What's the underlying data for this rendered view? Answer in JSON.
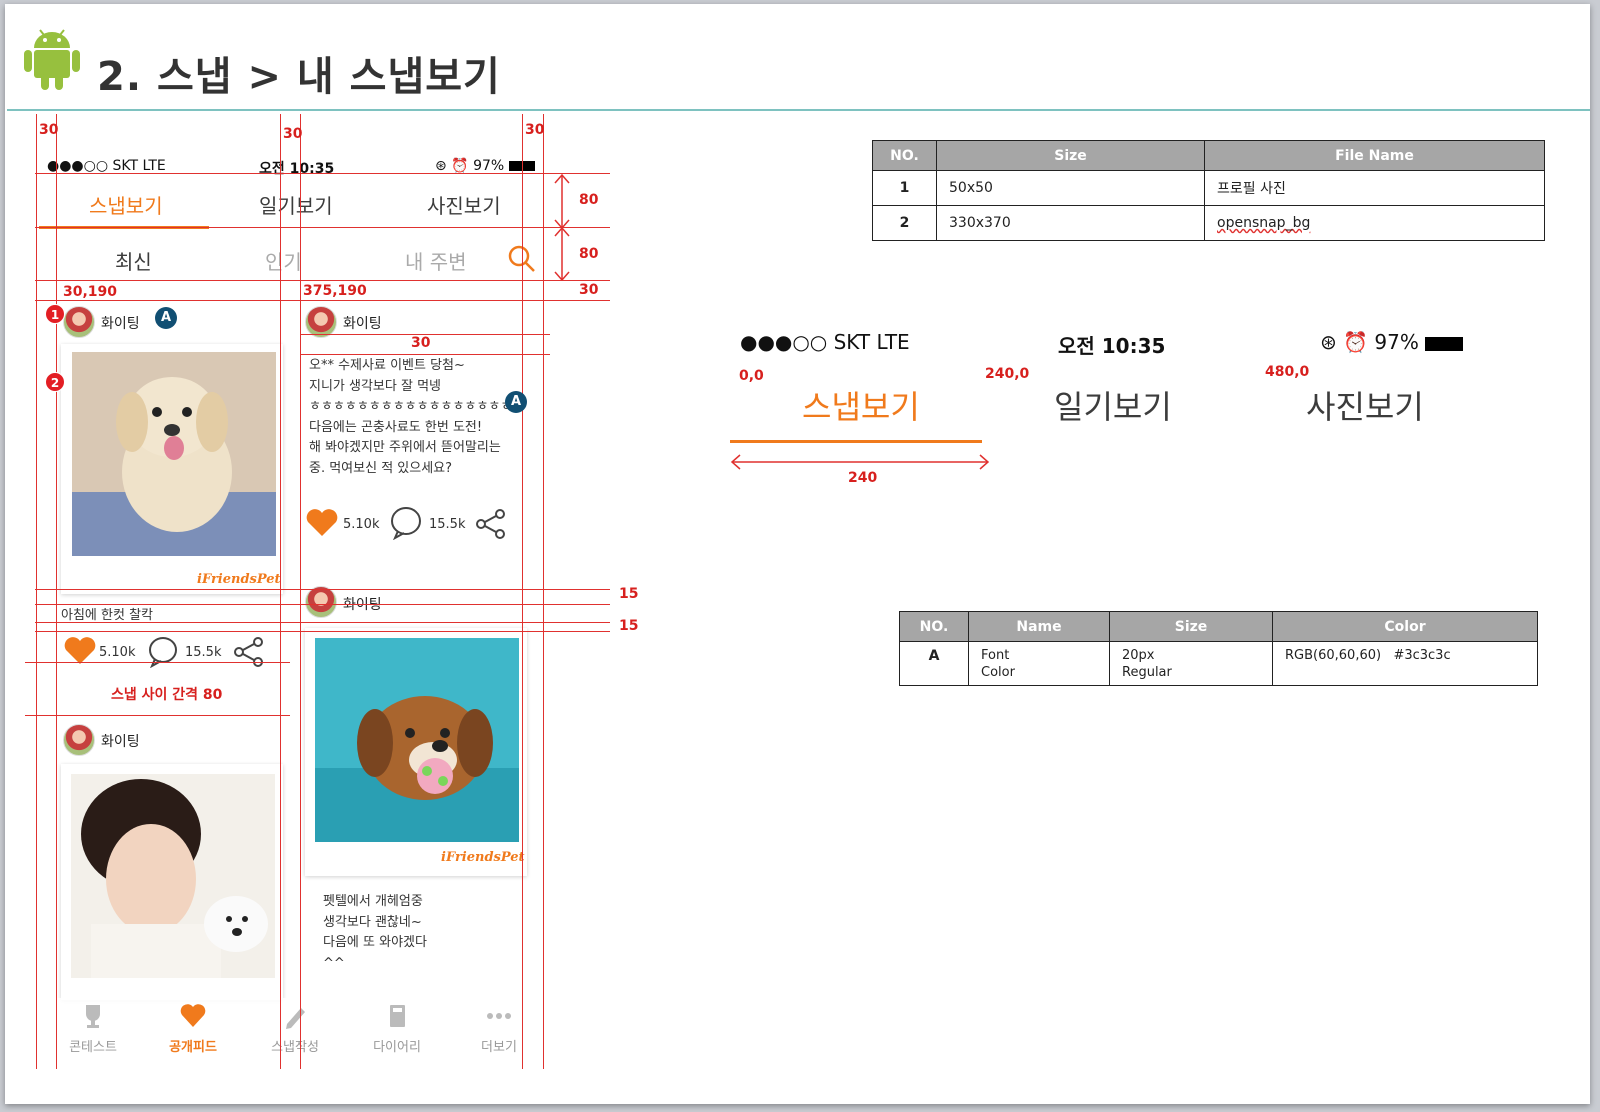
{
  "title": "2. 스냅 > 내 스냅보기",
  "status_bar": {
    "carrier": "●●●○○ SKT   LTE",
    "time": "오전 10:35",
    "battery": "97%"
  },
  "tabs": [
    "스냅보기",
    "일기보기",
    "사진보기"
  ],
  "subtabs": [
    "최신",
    "인기",
    "내 주변"
  ],
  "posts": {
    "user": "화이팅",
    "left1_caption": "아침에 한컷 찰칵",
    "right1_text": "오** 수제사료 이벤트 당첨~\n지니가 생각보다 잘 먹넹\nㅎㅎㅎㅎㅎㅎㅎㅎㅎㅎㅎㅎㅎㅎㅎㅎㅎ\n다음에는 곤충사료도 한번 도전!\n해 봐야겠지만 주위에서 뜯어말리는\n중. 먹여보신 적 있으세요?",
    "right2_text": "펫텔에서 개헤엄중\n생각보다 괜찮네~\n다음에 또 와야겠다\n^^",
    "likes": "5.10k",
    "comments": "15.5k",
    "brand": "iFriendsPet"
  },
  "bottom_nav": [
    "콘테스트",
    "공개피드",
    "스냅작성",
    "다이어리",
    "더보기"
  ],
  "annotations": {
    "m30a": "30",
    "m30b": "30",
    "m30c": "30",
    "h80a": "80",
    "h80b": "80",
    "h30": "30",
    "pos_left": "30,190",
    "pos_right": "375,190",
    "gap30": "30",
    "gap15a": "15",
    "gap15b": "15",
    "snap_gap": "스냅 사이 간격 80",
    "badge1": "1",
    "badge2": "2",
    "badgeA": "A",
    "z_pos0": "0,0",
    "z_pos240": "240,0",
    "z_pos480": "480,0",
    "z_width": "240"
  },
  "image_table": {
    "headers": [
      "NO.",
      "Size",
      "File Name"
    ],
    "rows": [
      [
        "1",
        "50x50",
        "프로필 사진"
      ],
      [
        "2",
        "330x370",
        "opensnap_bg"
      ]
    ]
  },
  "font_table": {
    "headers": [
      "NO.",
      "Name",
      "Size",
      "Color"
    ],
    "row": {
      "no": "A",
      "name1": "Font",
      "name2": "Color",
      "size1": "20px",
      "size2": "Regular",
      "color": "RGB(60,60,60)   #3c3c3c"
    }
  },
  "colors": {
    "accent": "#f07a1c",
    "guide": "#e0312f",
    "text": "#3c3c3c",
    "header_gray": "#a6a6a6"
  }
}
